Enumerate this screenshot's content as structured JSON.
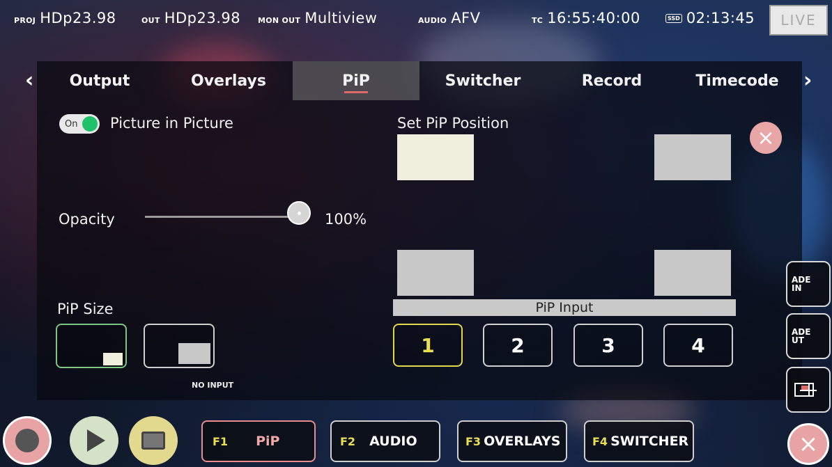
{
  "status": {
    "proj_key": "PROJ",
    "proj_val": "HDp23.98",
    "out_key": "OUT",
    "out_val": "HDp23.98",
    "monout_key": "MON OUT",
    "monout_val": "Multiview",
    "audio_key": "AUDIO",
    "audio_val": "AFV",
    "tc_key": "TC",
    "tc_val": "16:55:40:00",
    "ssd_badge": "SSD",
    "ssd_val": "02:13:45",
    "live_label": "LIVE"
  },
  "tabs": [
    "Output",
    "Overlays",
    "PiP",
    "Switcher",
    "Record",
    "Timecode"
  ],
  "active_tab": "PiP",
  "pip": {
    "toggle_text": "On",
    "toggle_on": true,
    "title": "Picture in Picture",
    "opacity_label": "Opacity",
    "opacity_value": "100%",
    "opacity_fraction": 1.0,
    "position_label": "Set PiP Position",
    "size_label": "PiP Size",
    "no_input": "NO INPUT",
    "input_label": "PiP Input",
    "inputs": [
      "1",
      "2",
      "3",
      "4"
    ],
    "selected_input": "1"
  },
  "side_buttons": {
    "fade_in": "ADE\nIN",
    "fade_out": "ADE\nUT"
  },
  "function_keys": [
    {
      "key": "F1",
      "label": "PiP"
    },
    {
      "key": "F2",
      "label": "AUDIO"
    },
    {
      "key": "F3",
      "label": "OVERLAYS"
    },
    {
      "key": "F4",
      "label": "SWITCHER"
    }
  ],
  "colors": {
    "accent_yellow": "#e2d94a",
    "toggle_green": "#1fc26b",
    "active_underline": "#e06a6a",
    "size_selected": "#7cc783"
  }
}
